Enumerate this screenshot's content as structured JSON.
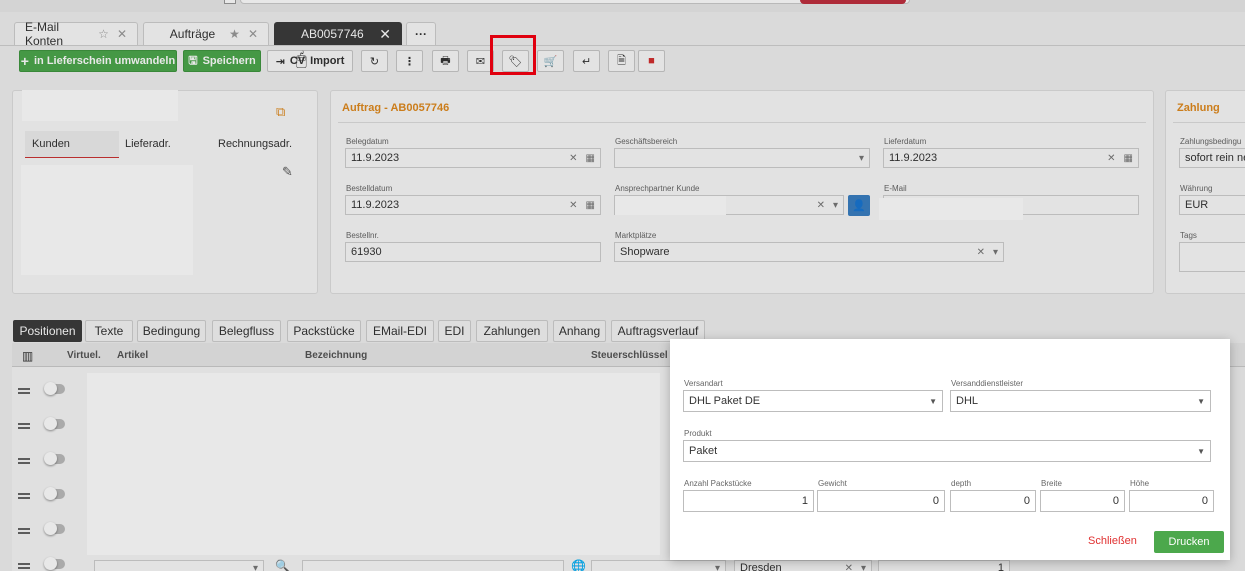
{
  "tabs": [
    {
      "label": "E-Mail Konten"
    },
    {
      "label": "Aufträge"
    },
    {
      "label": "AB0057746"
    }
  ],
  "tab_more": "···",
  "toolbar": {
    "convert_label": "in Lieferschein umwandeln",
    "save_label": "Speichern",
    "import_label": "Import",
    "import_partial": "C",
    "import_partial2": "V"
  },
  "customer": {
    "subtabs": [
      "Kunden",
      "Lieferadr.",
      "Rechnungsadr."
    ]
  },
  "order": {
    "title": "Auftrag - AB0057746",
    "belegdatum_label": "Belegdatum",
    "belegdatum": "11.9.2023",
    "geschaeftsbereich_label": "Geschäftsbereich",
    "geschaeftsbereich": "",
    "lieferdatum_label": "Lieferdatum",
    "lieferdatum": "11.9.2023",
    "bestelldatum_label": "Bestelldatum",
    "bestelldatum": "11.9.2023",
    "ansprechpartner_label": "Ansprechpartner Kunde",
    "email_label": "E-Mail",
    "bestellnr_label": "Bestellnr.",
    "bestellnr": "61930",
    "marktplaetze_label": "Marktplätze",
    "marktplaetze": "Shopware"
  },
  "payment": {
    "title": "Zahlung",
    "bedingung_label": "Zahlungsbedingu",
    "bedingung": "sofort rein ne",
    "waehrung_label": "Währung",
    "waehrung": "EUR",
    "tags_label": "Tags"
  },
  "bottom_tabs": [
    "Positionen",
    "Texte",
    "Bedingung",
    "Belegfluss",
    "Packstücke",
    "EMail-EDI",
    "EDI",
    "Zahlungen",
    "Anhang",
    "Auftragsverlauf"
  ],
  "grid": {
    "col_virtuel": "Virtuel.",
    "col_artikel": "Artikel",
    "col_bezeichnung": "Bezeichnung",
    "col_steuer": "Steuerschlüssel",
    "partial_city": "Dresden",
    "partial_qty": "1"
  },
  "modal": {
    "versandart_label": "Versandart",
    "versandart": "DHL Paket DE",
    "dienstleister_label": "Versanddienstleister",
    "dienstleister": "DHL",
    "produkt_label": "Produkt",
    "produkt": "Paket",
    "anzahl_label": "Anzahl Packstücke",
    "anzahl": "1",
    "gewicht_label": "Gewicht",
    "gewicht": "0",
    "depth_label": "depth",
    "depth": "0",
    "breite_label": "Breite",
    "breite": "0",
    "hoehe_label": "Höhe",
    "hoehe": "0",
    "close_label": "Schließen",
    "print_label": "Drucken"
  },
  "colors": {
    "accent_green": "#4ca84c",
    "title_orange": "#e08a1e",
    "highlight_red": "#e0000f",
    "close_red": "#e03030"
  }
}
